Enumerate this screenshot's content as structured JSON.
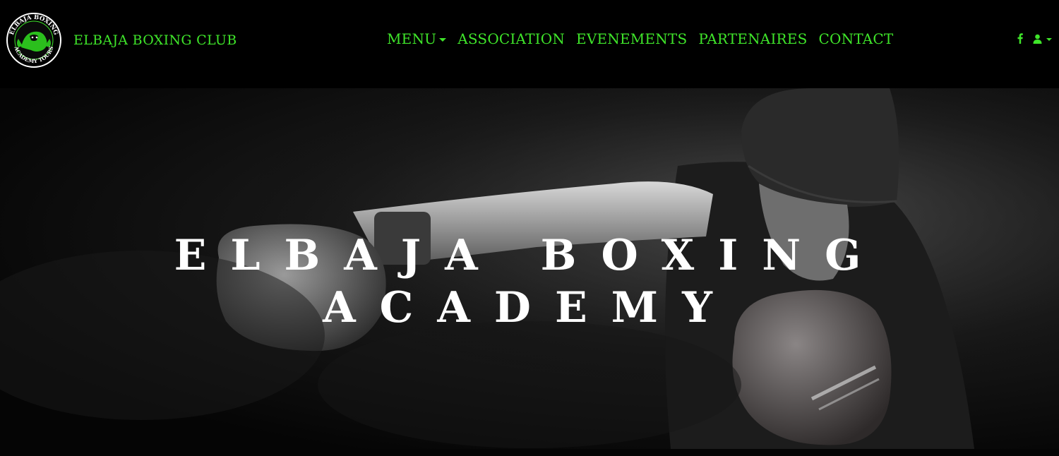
{
  "brand": {
    "name": "ELBAJA BOXING CLUB",
    "logo_text_top": "ELBAJA BOXING",
    "logo_text_bottom": "ACADEMY TOURS"
  },
  "nav": {
    "items": [
      {
        "label": "MENU",
        "dropdown": true
      },
      {
        "label": "ASSOCIATION",
        "dropdown": false
      },
      {
        "label": "EVENEMENTS",
        "dropdown": false
      },
      {
        "label": "PARTENAIRES",
        "dropdown": false
      },
      {
        "label": "CONTACT",
        "dropdown": false
      }
    ]
  },
  "icons": {
    "social": "facebook-icon",
    "user": "user-icon"
  },
  "hero": {
    "title_line1": "ELBAJA BOXING",
    "title_line2": "ACADEMY"
  },
  "colors": {
    "accent": "#3fe52a",
    "background": "#000000",
    "hero_text": "#ffffff"
  }
}
